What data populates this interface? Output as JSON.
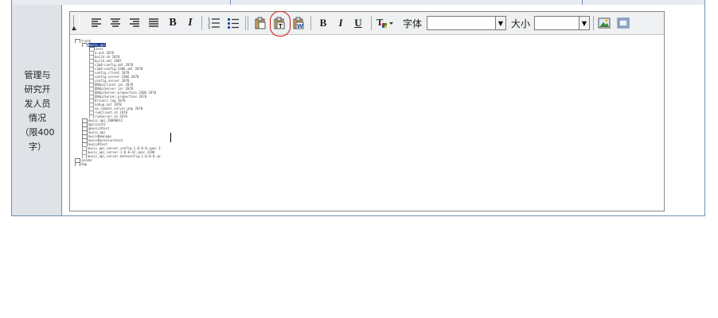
{
  "label": {
    "text": "管理与\n研究开\n发人员\n情况\n（限400\n字）"
  },
  "toolbar": {
    "font_label": "字体",
    "size_label": "大小",
    "font_value": "",
    "size_value": "",
    "highlighted_button": "paste-from-word-icon"
  },
  "tree": {
    "rows": [
      {
        "indent": 0,
        "text": "trunk",
        "kind": "folder"
      },
      {
        "indent": 1,
        "text": "music_api",
        "kind": "folder",
        "selected": true
      },
      {
        "indent": 2,
        "text": "test",
        "kind": "folder"
      },
      {
        "indent": 2,
        "text": "a.out 2878",
        "kind": "file"
      },
      {
        "indent": 2,
        "text": "build.sh 2878",
        "kind": "file"
      },
      {
        "indent": 2,
        "text": "build.xml 2607",
        "kind": "file"
      },
      {
        "indent": 2,
        "text": "c3p0-config.xml 2878",
        "kind": "file"
      },
      {
        "indent": 2,
        "text": "c3p0-config-3306.xml 2878",
        "kind": "file"
      },
      {
        "indent": 2,
        "text": "config.client 2878",
        "kind": "file"
      },
      {
        "indent": 2,
        "text": "config.server.3306 2878",
        "kind": "file"
      },
      {
        "indent": 2,
        "text": "config.server 2878",
        "kind": "file"
      },
      {
        "indent": 2,
        "text": "DBApiClient.jar 2878",
        "kind": "file"
      },
      {
        "indent": 2,
        "text": "DBApiServer.jar 2878",
        "kind": "file"
      },
      {
        "indent": 2,
        "text": "DBApiServer.properties.3306 2878",
        "kind": "file"
      },
      {
        "indent": 2,
        "text": "DBApiServer.properties 2878",
        "kind": "file"
      },
      {
        "indent": 2,
        "text": "Drivers.log 2878",
        "kind": "file"
      },
      {
        "indent": 2,
        "text": "nohup.out 2878",
        "kind": "file"
      },
      {
        "indent": 2,
        "text": "sp_remote_server.php 2878",
        "kind": "file"
      },
      {
        "indent": 2,
        "text": "runClient.sh 2878",
        "kind": "file"
      },
      {
        "indent": 2,
        "text": "runServer.sh 2878",
        "kind": "file"
      },
      {
        "indent": 1,
        "text": "music_api_20090612",
        "kind": "folder"
      },
      {
        "indent": 1,
        "text": "mpclient2",
        "kind": "folder"
      },
      {
        "indent": 1,
        "text": "gmusicAtest",
        "kind": "folder"
      },
      {
        "indent": 1,
        "text": "music_api",
        "kind": "folder"
      },
      {
        "indent": 1,
        "text": "musicBmanage",
        "kind": "folder"
      },
      {
        "indent": 1,
        "text": "musicBpressuretest",
        "kind": "folder"
      },
      {
        "indent": 1,
        "text": "musicBtest",
        "kind": "folder"
      },
      {
        "indent": 1,
        "text": "music_api_server_config-1.0.0-8.spec 3",
        "kind": "file"
      },
      {
        "indent": 1,
        "text": "music_api_server-1.0.0-42.spec 3198",
        "kind": "file"
      },
      {
        "indent": 1,
        "text": "music_api_server-betaconfig-1.0.0-8.sp",
        "kind": "file"
      },
      {
        "indent": 0,
        "text": "spider",
        "kind": "folder"
      },
      {
        "indent": 0,
        "text": "tmp",
        "kind": "folder"
      }
    ]
  }
}
